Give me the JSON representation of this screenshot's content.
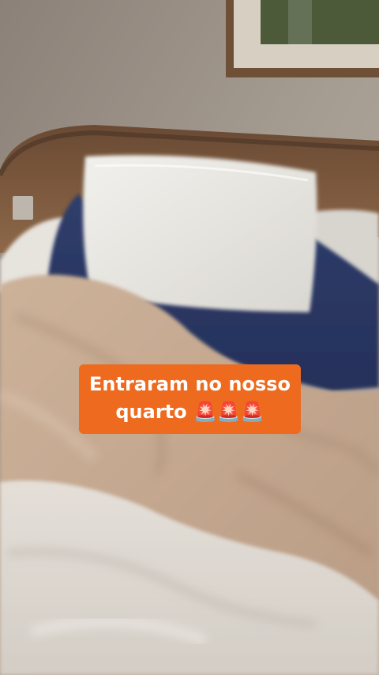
{
  "caption": {
    "line1": "Entraram no nosso",
    "line2": "quarto 🚨🚨🚨",
    "background": "#ee6a1e",
    "text_color": "#ffffff"
  }
}
